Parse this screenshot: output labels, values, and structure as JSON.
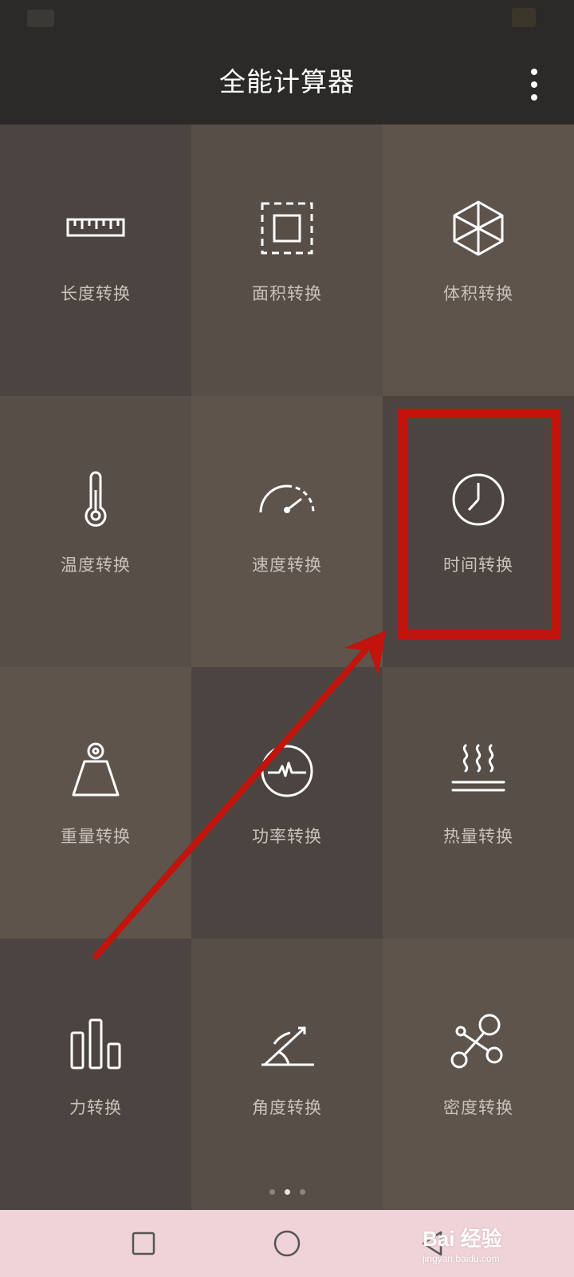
{
  "app": {
    "title": "全能计算器",
    "menu_icon": "more-vertical-icon"
  },
  "colors": {
    "header_bg": "#2b2a29",
    "tile_dark": "#4c4440",
    "tile_mid": "#574e47",
    "tile_light": "#5f544c",
    "annotation_red": "#c0140c",
    "nav_bg": "#efd3d8"
  },
  "tiles": [
    {
      "label": "长度转换",
      "icon": "ruler-icon"
    },
    {
      "label": "面积转换",
      "icon": "area-square-icon"
    },
    {
      "label": "体积转换",
      "icon": "cube-icon"
    },
    {
      "label": "温度转换",
      "icon": "thermometer-icon"
    },
    {
      "label": "速度转换",
      "icon": "speedometer-icon"
    },
    {
      "label": "时间转换",
      "icon": "clock-icon"
    },
    {
      "label": "重量转换",
      "icon": "weight-icon"
    },
    {
      "label": "功率转换",
      "icon": "power-pulse-icon"
    },
    {
      "label": "热量转换",
      "icon": "heat-icon"
    },
    {
      "label": "力转换",
      "icon": "bar-chart-icon"
    },
    {
      "label": "角度转换",
      "icon": "angle-icon"
    },
    {
      "label": "密度转换",
      "icon": "molecule-icon"
    }
  ],
  "pager": {
    "count": 3,
    "active": 2
  },
  "nav": {
    "recent_icon": "square-icon",
    "home_icon": "circle-icon",
    "back_icon": "triangle-back-icon"
  },
  "watermark": {
    "main": "Bai 经验",
    "sub": "jingyan.baidu.com"
  }
}
